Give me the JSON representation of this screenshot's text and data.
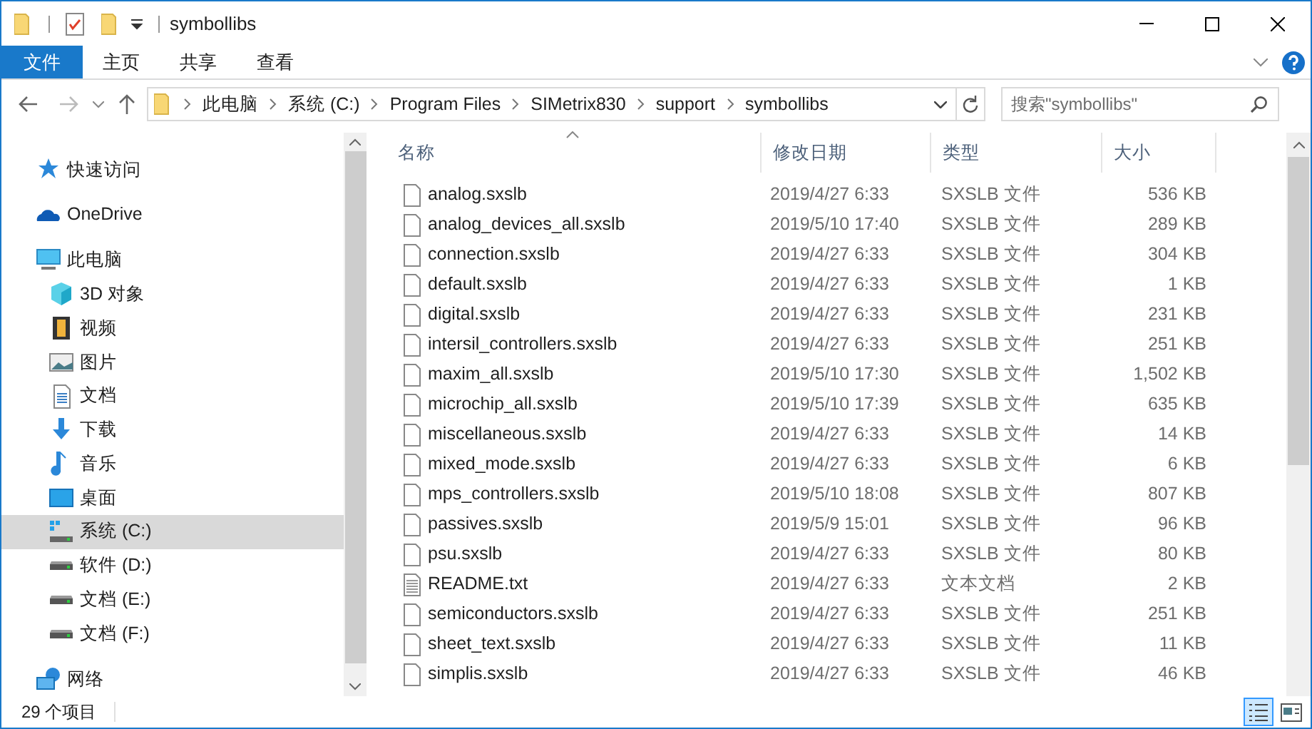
{
  "window": {
    "title": "symbollibs"
  },
  "ribbon_tabs": [
    {
      "label": "文件",
      "kind": "file_menu"
    },
    {
      "label": "主页",
      "kind": "tab"
    },
    {
      "label": "共享",
      "kind": "tab"
    },
    {
      "label": "查看",
      "kind": "tab"
    }
  ],
  "address_bar": {
    "path": [
      "此电脑",
      "系统 (C:)",
      "Program Files",
      "SIMetrix830",
      "support",
      "symbollibs"
    ]
  },
  "search": {
    "placeholder": "搜索\"symbollibs\""
  },
  "sidebar": {
    "items": [
      {
        "label": "快速访问",
        "kind": "star",
        "selected": false
      },
      {
        "label": "OneDrive",
        "kind": "cloud",
        "selected": false
      },
      {
        "label": "此电脑",
        "kind": "pc",
        "selected": false,
        "children": [
          {
            "label": "3D 对象",
            "kind": "cube",
            "selected": false
          },
          {
            "label": "视频",
            "kind": "film",
            "selected": false
          },
          {
            "label": "图片",
            "kind": "image",
            "selected": false
          },
          {
            "label": "文档",
            "kind": "doc",
            "selected": false
          },
          {
            "label": "下载",
            "kind": "download",
            "selected": false
          },
          {
            "label": "音乐",
            "kind": "music",
            "selected": false
          },
          {
            "label": "桌面",
            "kind": "desktop",
            "selected": false
          },
          {
            "label": "系统 (C:)",
            "kind": "system_drive",
            "selected": true
          },
          {
            "label": "软件 (D:)",
            "kind": "drive",
            "selected": false
          },
          {
            "label": "文档 (E:)",
            "kind": "drive",
            "selected": false
          },
          {
            "label": "文档 (F:)",
            "kind": "drive",
            "selected": false
          }
        ]
      },
      {
        "label": "网络",
        "kind": "network",
        "selected": false
      }
    ]
  },
  "file_list": {
    "columns": [
      {
        "label": "名称",
        "sorted": true
      },
      {
        "label": "修改日期",
        "sorted": false
      },
      {
        "label": "类型",
        "sorted": false
      },
      {
        "label": "大小",
        "sorted": false
      }
    ],
    "rows": [
      {
        "name": "analog.sxslb",
        "modified": "2019/4/27 6:33",
        "type": "SXSLB 文件",
        "size": "536 KB",
        "kind": "file"
      },
      {
        "name": "analog_devices_all.sxslb",
        "modified": "2019/5/10 17:40",
        "type": "SXSLB 文件",
        "size": "289 KB",
        "kind": "file"
      },
      {
        "name": "connection.sxslb",
        "modified": "2019/4/27 6:33",
        "type": "SXSLB 文件",
        "size": "304 KB",
        "kind": "file"
      },
      {
        "name": "default.sxslb",
        "modified": "2019/4/27 6:33",
        "type": "SXSLB 文件",
        "size": "1 KB",
        "kind": "file"
      },
      {
        "name": "digital.sxslb",
        "modified": "2019/4/27 6:33",
        "type": "SXSLB 文件",
        "size": "231 KB",
        "kind": "file"
      },
      {
        "name": "intersil_controllers.sxslb",
        "modified": "2019/4/27 6:33",
        "type": "SXSLB 文件",
        "size": "251 KB",
        "kind": "file"
      },
      {
        "name": "maxim_all.sxslb",
        "modified": "2019/5/10 17:30",
        "type": "SXSLB 文件",
        "size": "1,502 KB",
        "kind": "file"
      },
      {
        "name": "microchip_all.sxslb",
        "modified": "2019/5/10 17:39",
        "type": "SXSLB 文件",
        "size": "635 KB",
        "kind": "file"
      },
      {
        "name": "miscellaneous.sxslb",
        "modified": "2019/4/27 6:33",
        "type": "SXSLB 文件",
        "size": "14 KB",
        "kind": "file"
      },
      {
        "name": "mixed_mode.sxslb",
        "modified": "2019/4/27 6:33",
        "type": "SXSLB 文件",
        "size": "6 KB",
        "kind": "file"
      },
      {
        "name": "mps_controllers.sxslb",
        "modified": "2019/5/10 18:08",
        "type": "SXSLB 文件",
        "size": "807 KB",
        "kind": "file"
      },
      {
        "name": "passives.sxslb",
        "modified": "2019/5/9 15:01",
        "type": "SXSLB 文件",
        "size": "96 KB",
        "kind": "file"
      },
      {
        "name": "psu.sxslb",
        "modified": "2019/4/27 6:33",
        "type": "SXSLB 文件",
        "size": "80 KB",
        "kind": "file"
      },
      {
        "name": "README.txt",
        "modified": "2019/4/27 6:33",
        "type": "文本文档",
        "size": "2 KB",
        "kind": "text"
      },
      {
        "name": "semiconductors.sxslb",
        "modified": "2019/4/27 6:33",
        "type": "SXSLB 文件",
        "size": "251 KB",
        "kind": "file"
      },
      {
        "name": "sheet_text.sxslb",
        "modified": "2019/4/27 6:33",
        "type": "SXSLB 文件",
        "size": "11 KB",
        "kind": "file"
      },
      {
        "name": "simplis.sxslb",
        "modified": "2019/4/27 6:33",
        "type": "SXSLB 文件",
        "size": "46 KB",
        "kind": "file"
      }
    ]
  },
  "status_bar": {
    "item_count": "29 个项目"
  },
  "view_buttons": [
    {
      "kind": "details",
      "selected": true
    },
    {
      "kind": "large_icons",
      "selected": false
    }
  ]
}
